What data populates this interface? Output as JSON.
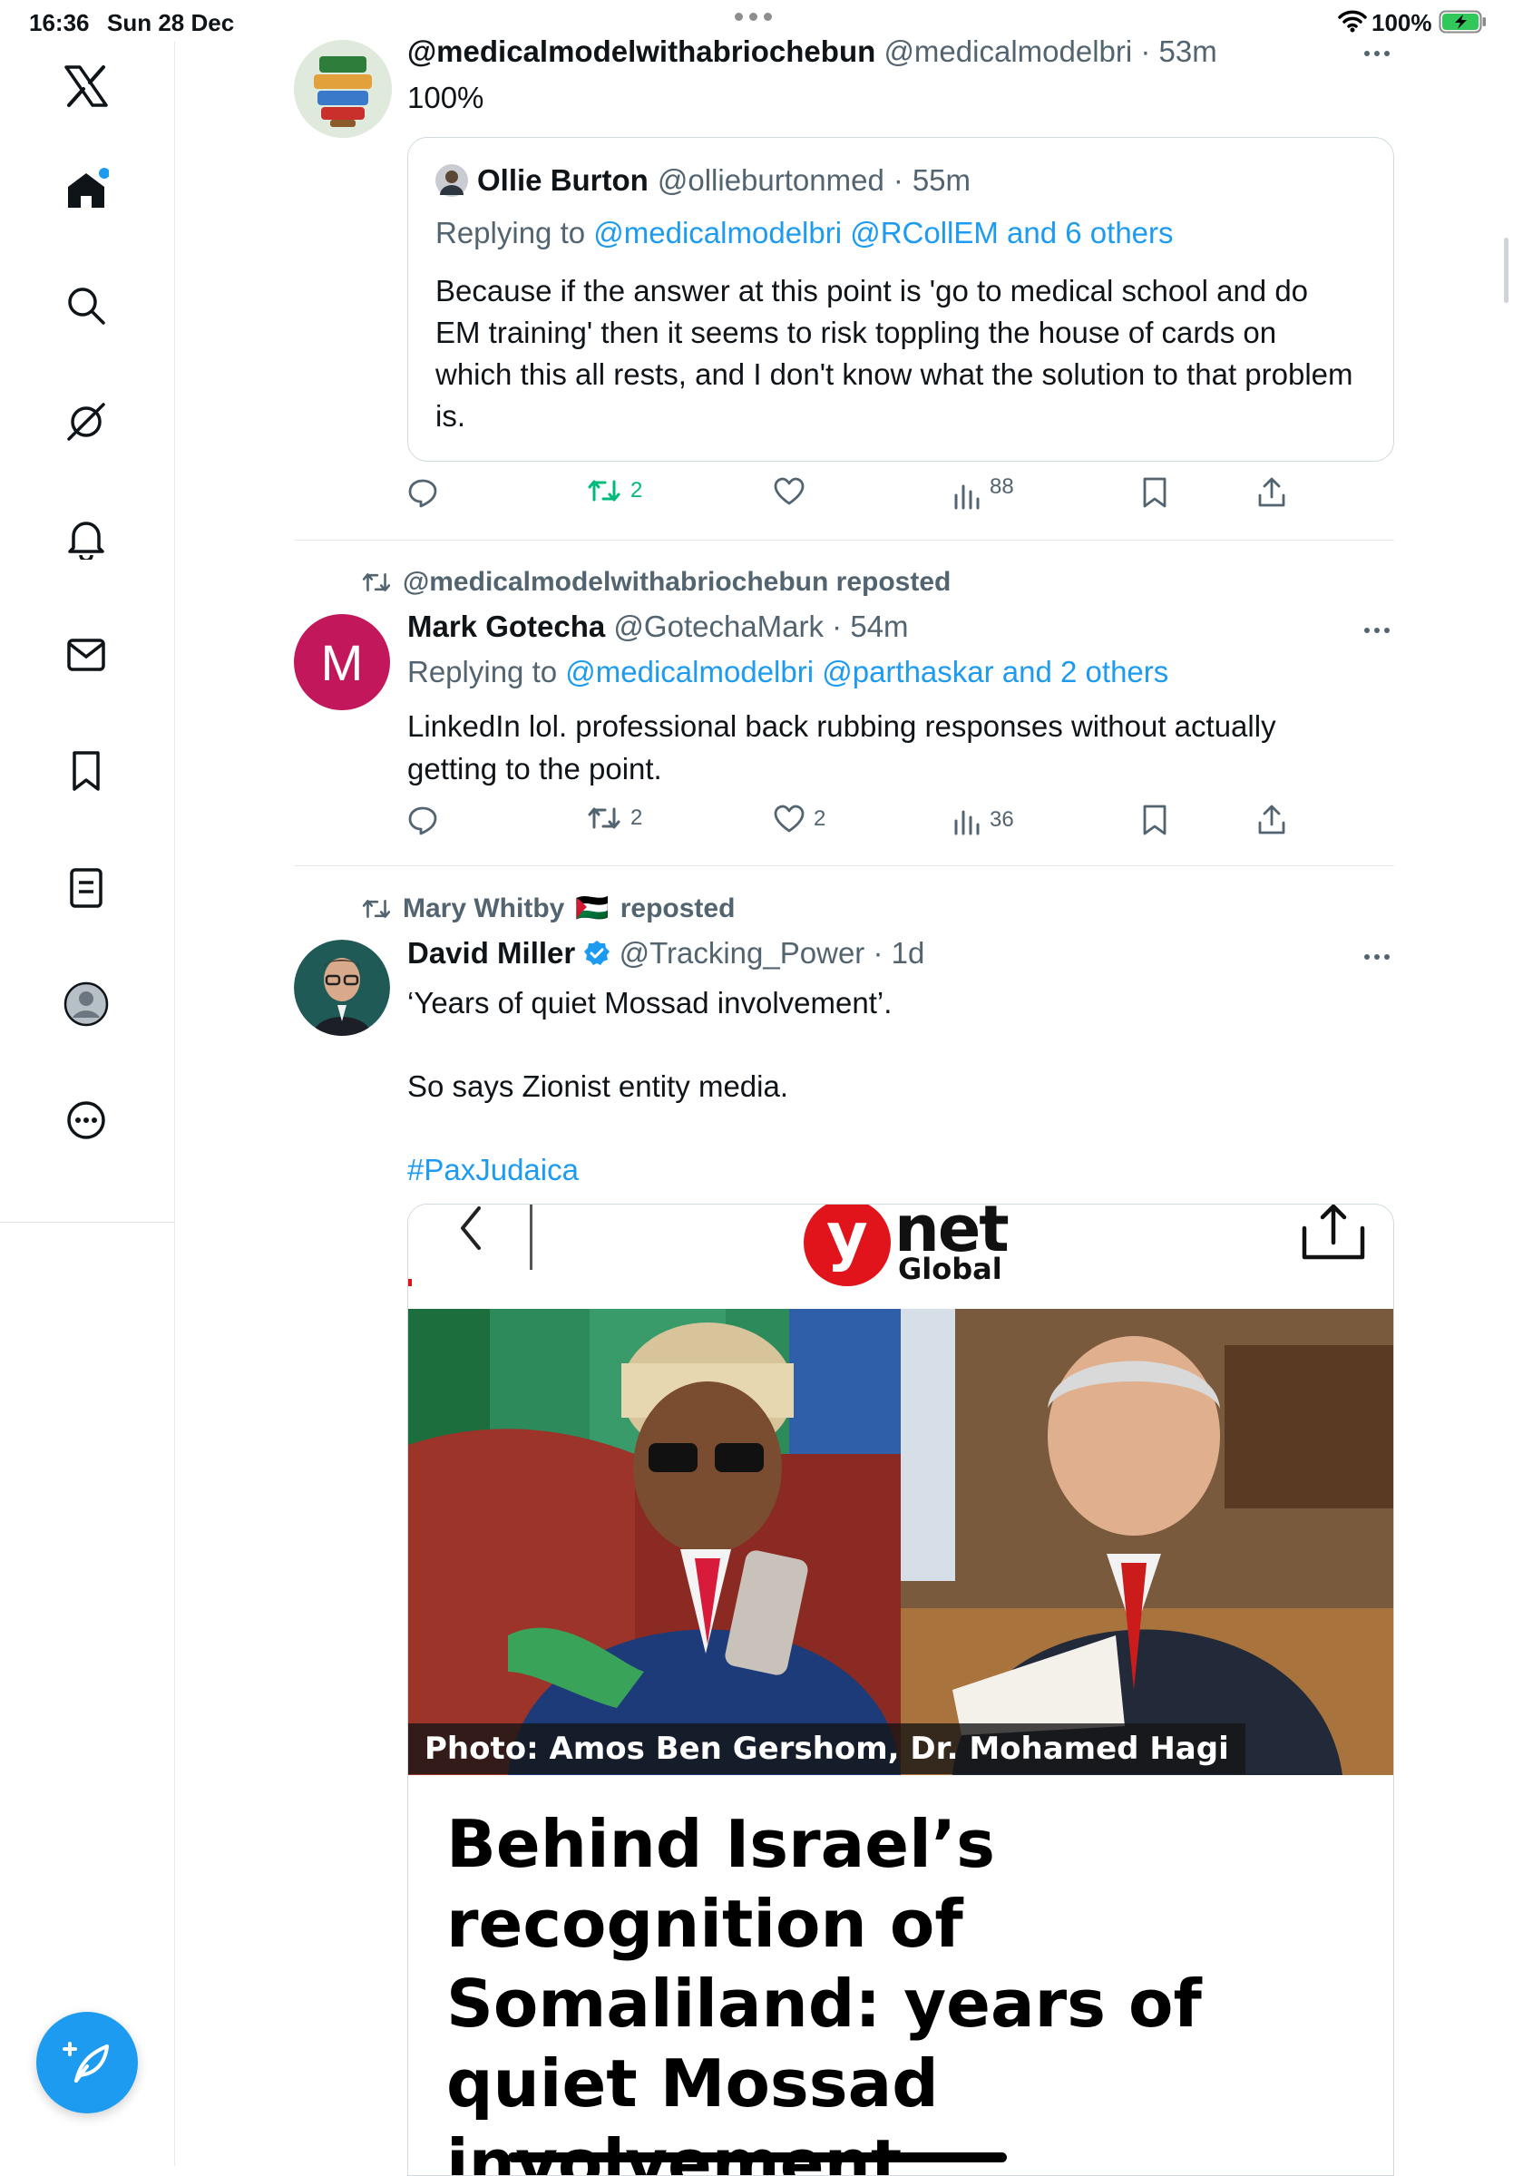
{
  "status_bar": {
    "time": "16:36",
    "date": "Sun 28 Dec",
    "battery": "100%"
  },
  "sidebar": {
    "items": [
      {
        "name": "x-logo-icon"
      },
      {
        "name": "home-icon"
      },
      {
        "name": "search-icon"
      },
      {
        "name": "grok-icon"
      },
      {
        "name": "notifications-icon"
      },
      {
        "name": "messages-icon"
      },
      {
        "name": "bookmarks-icon"
      },
      {
        "name": "lists-icon"
      },
      {
        "name": "profile-icon"
      },
      {
        "name": "more-icon"
      }
    ],
    "compose_icon": "compose-icon"
  },
  "tweets": [
    {
      "display_name": "@medicalmodelwithabriochebun",
      "handle": "@medicalmodelbri",
      "time": "53m",
      "text": "100%",
      "quote": {
        "display_name": "Ollie Burton",
        "handle": "@ollieburtonmed",
        "time": "55m",
        "replying_prefix": "Replying to",
        "replying_targets": "@medicalmodelbri @RCollEM and 6 others",
        "text": "Because if the answer at this point is 'go to medical school and do EM training' then it seems to risk toppling the house of cards on which this all rests, and I don't know what the solution to that problem is."
      },
      "actions": {
        "replies": "",
        "reposts": "2",
        "likes": "",
        "views": "88"
      }
    },
    {
      "repost_label": "@medicalmodelwithabriochebun reposted",
      "avatar_letter": "M",
      "display_name": "Mark Gotecha",
      "handle": "@GotechaMark",
      "time": "54m",
      "replying_prefix": "Replying to",
      "replying_targets": "@medicalmodelbri @parthaskar and 2 others",
      "text": "LinkedIn lol. professional back rubbing responses without actually getting to the point.",
      "actions": {
        "replies": "",
        "reposts": "2",
        "likes": "2",
        "views": "36"
      }
    },
    {
      "repost_name": "Mary Whitby",
      "repost_flag": "🇵🇸",
      "repost_suffix": "reposted",
      "display_name": "David Miller",
      "verified": true,
      "handle": "@Tracking_Power",
      "time": "1d",
      "text_line1": "‘Years of quiet Mossad involvement’.",
      "text_line2": "So says Zionist entity media.",
      "hashtag": "#PaxJudaica",
      "card": {
        "logo_y": "y",
        "logo_net": "net",
        "logo_global": "Global",
        "caption": "Photo: Amos Ben Gershom, Dr. Mohamed Hagi",
        "headline": "Behind Israel’s recognition of Somaliland: years of quiet Mossad involvement"
      }
    }
  ],
  "colors": {
    "accent": "#1d9bf0",
    "repost_green": "#00ba7c",
    "muted": "#536471",
    "ynet_red": "#e1141c"
  }
}
